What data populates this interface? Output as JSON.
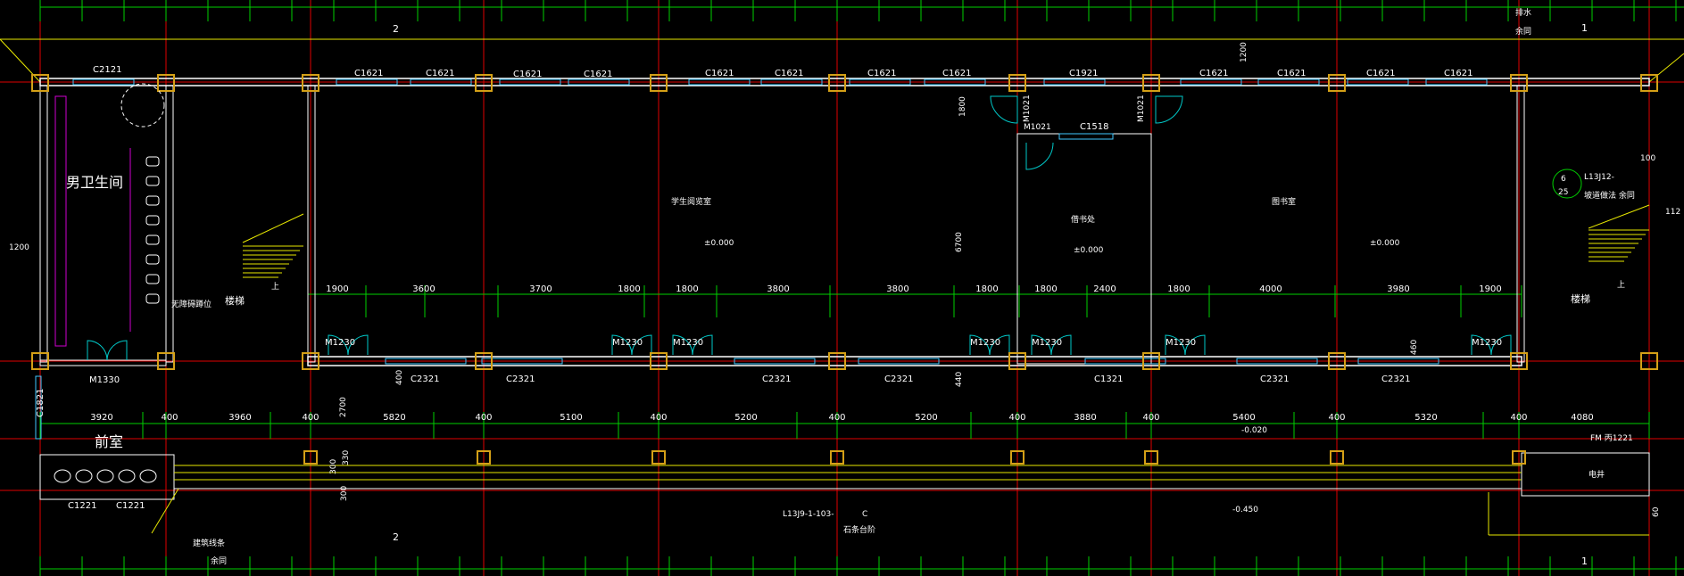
{
  "colors": {
    "background": "#000000",
    "axis": "#e00000",
    "wall": "#ffffff",
    "dimension": "#00d000",
    "column": "#d4a017",
    "window": "#40c8ff",
    "yellow": "#e8e800",
    "magenta": "#d000d0",
    "door": "#00c8c8"
  },
  "top_windows": [
    "C2121",
    "C1621",
    "C1621",
    "C1621",
    "C1621",
    "C1621",
    "C1621",
    "C1621",
    "C1621",
    "C1921",
    "C1621",
    "C1621",
    "C1621",
    "C1621"
  ],
  "bottom_windows": [
    "C2321",
    "C2321",
    "C2321",
    "C2321",
    "C1321",
    "C2321",
    "C2321"
  ],
  "doors_bottom": [
    "M1230",
    "M1230",
    "M1230",
    "M1230",
    "M1230",
    "M1230",
    "M1230"
  ],
  "doors_misc": [
    "M1330",
    "M1021",
    "M1021",
    "M1021",
    "FM 丙1221"
  ],
  "window_misc": [
    "C1518",
    "C1821",
    "C1221",
    "C1221"
  ],
  "rooms": {
    "mens_wc": "男卫生间",
    "stair_left": "楼梯",
    "room1": "学生阅览室",
    "room2": "借书处",
    "room3": "图书室",
    "vestibule": "前室",
    "elec": "电井",
    "stair_right": "楼梯"
  },
  "notes": {
    "drain": "排水",
    "same": "余同",
    "barrier_free": "无障碍蹲位",
    "up": "上",
    "stair_ref": "L13J12-",
    "stair_ref2": "坡道做法 余同",
    "circle_top": "6",
    "circle_bottom": "25",
    "step_ref": "L13J9-1-103-",
    "step_circle": "C",
    "step_name": "石条台阶",
    "building_line": "建筑线条",
    "same2": "余同",
    "section_2_top": "2",
    "section_1_top": "1",
    "section_2_bottom": "2",
    "section_1_bottom": "1"
  },
  "levels": {
    "room1": "±0.000",
    "room2": "±0.000",
    "room3": "±0.000",
    "corridor": "-0.020",
    "outdoor": "-0.450"
  },
  "dims_inner": [
    "1900",
    "3600",
    "3700",
    "1800",
    "1800",
    "3800",
    "3800",
    "1800",
    "1800",
    "2400",
    "1800",
    "4000",
    "3980",
    "1900"
  ],
  "dims_axis": [
    "3920",
    "400",
    "3960",
    "400",
    "5820",
    "400",
    "5100",
    "400",
    "5200",
    "400",
    "5200",
    "400",
    "3880",
    "400",
    "5400",
    "400",
    "5320",
    "400",
    "4080"
  ],
  "dims_vertical": {
    "left": "1200",
    "top_mid": "1200",
    "room2_top": "1800",
    "room2_h": "6700",
    "wall_a": "400",
    "wall_b": "440",
    "wall_c": "460",
    "corr": "2700",
    "s1": "300",
    "s2": "330",
    "s3": "300",
    "right_top": "100",
    "right_mid": "112",
    "right_bot": "60"
  }
}
